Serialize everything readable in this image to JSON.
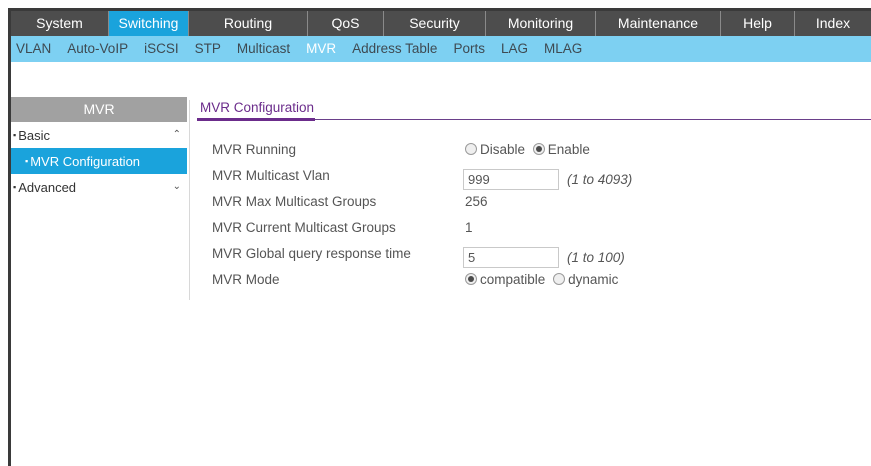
{
  "top_menu": {
    "items": [
      {
        "label": "System",
        "active": false
      },
      {
        "label": "Switching",
        "active": true
      },
      {
        "label": "Routing",
        "active": false
      },
      {
        "label": "QoS",
        "active": false
      },
      {
        "label": "Security",
        "active": false
      },
      {
        "label": "Monitoring",
        "active": false
      },
      {
        "label": "Maintenance",
        "active": false
      },
      {
        "label": "Help",
        "active": false
      },
      {
        "label": "Index",
        "active": false
      }
    ]
  },
  "sub_menu": {
    "items": [
      {
        "label": "VLAN",
        "active": false
      },
      {
        "label": "Auto-VoIP",
        "active": false
      },
      {
        "label": "iSCSI",
        "active": false
      },
      {
        "label": "STP",
        "active": false
      },
      {
        "label": "Multicast",
        "active": false
      },
      {
        "label": "MVR",
        "active": true
      },
      {
        "label": "Address Table",
        "active": false
      },
      {
        "label": "Ports",
        "active": false
      },
      {
        "label": "LAG",
        "active": false
      },
      {
        "label": "MLAG",
        "active": false
      }
    ]
  },
  "left_nav": {
    "header": "MVR",
    "items": [
      {
        "label": "Basic",
        "expanded": true,
        "chevron": "up-icon"
      },
      {
        "label": "MVR Configuration",
        "selected": true
      },
      {
        "label": "Advanced",
        "expanded": false,
        "chevron": "down-icon"
      }
    ]
  },
  "content": {
    "tab_title": "MVR Configuration",
    "fields": {
      "mvr_running": {
        "label": "MVR Running",
        "options": [
          "Disable",
          "Enable"
        ],
        "selected": "Enable"
      },
      "multicast_vlan": {
        "label": "MVR Multicast Vlan",
        "value": "999",
        "range": "(1 to 4093)"
      },
      "max_groups": {
        "label": "MVR Max Multicast Groups",
        "value": "256"
      },
      "current_groups": {
        "label": "MVR Current Multicast Groups",
        "value": "1"
      },
      "query_response_time": {
        "label": "MVR Global query response time",
        "value": "5",
        "range": "(1 to 100)"
      },
      "mvr_mode": {
        "label": "MVR Mode",
        "options": [
          "compatible",
          "dynamic"
        ],
        "selected": "compatible"
      }
    }
  },
  "colors": {
    "top_menu_bg": "#4d4d4d",
    "accent_blue": "#1aa3dc",
    "submenu_bg": "#7dd0f2",
    "tab_purple": "#6b2c8b",
    "nav_header_gray": "#a1a1a1"
  }
}
